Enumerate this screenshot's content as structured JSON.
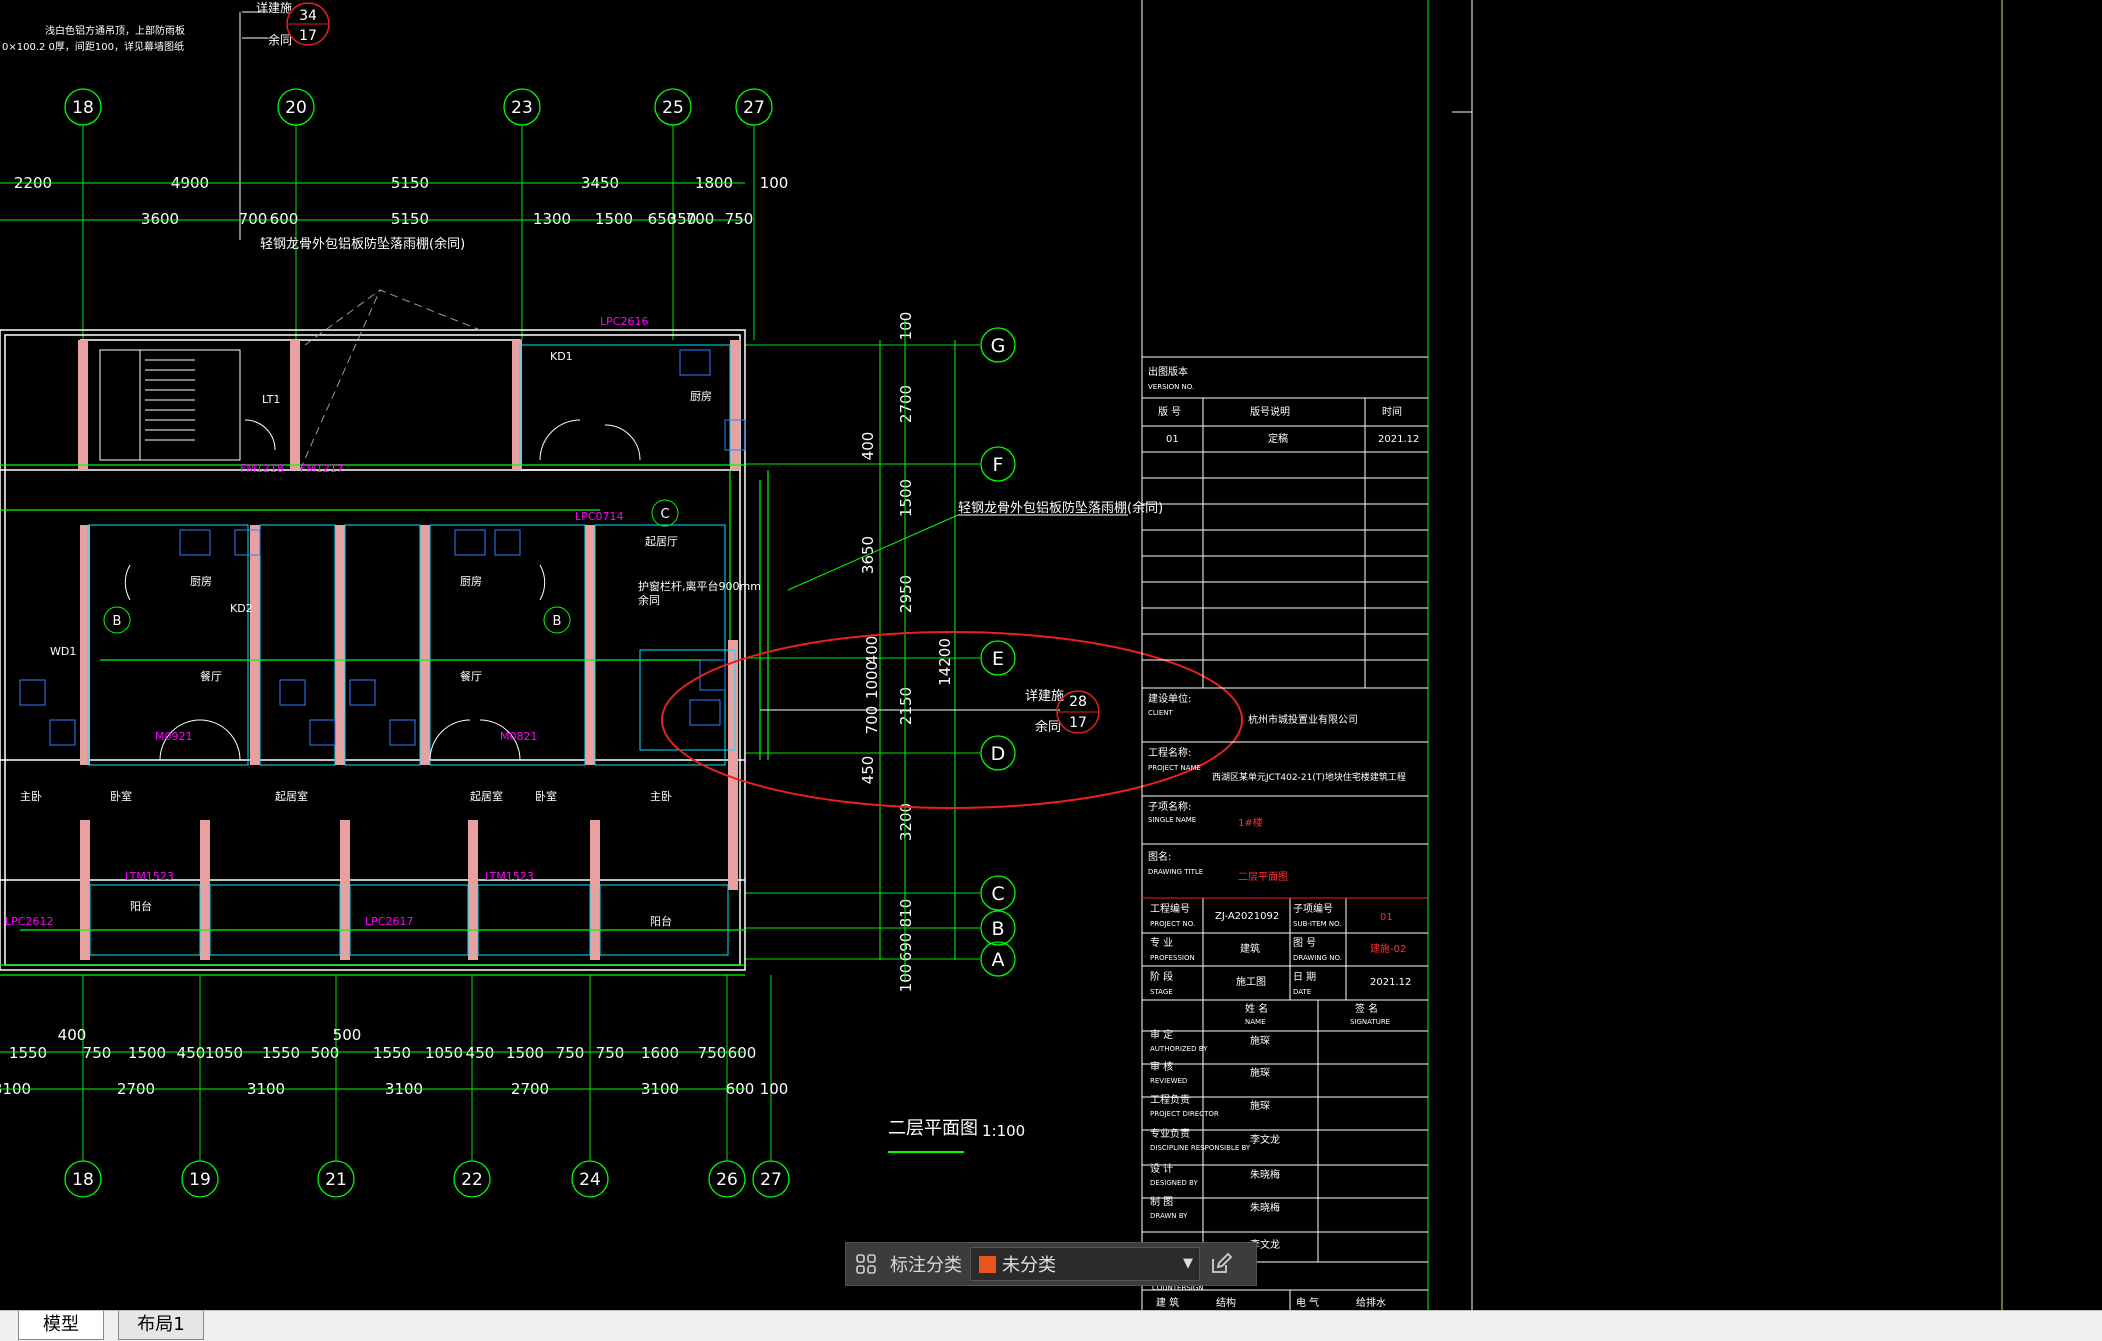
{
  "tabs": [
    {
      "label": "模型",
      "active": true
    },
    {
      "label": "布局1",
      "active": false
    }
  ],
  "annotation_toolbar": {
    "label": "标注分类",
    "selected_category": "未分类",
    "swatch_color": "#e8561b"
  },
  "drawing": {
    "title": "二层平面图",
    "scale": "1:100",
    "top_note_1": "浅白色铝方通吊顶，上部防雨板",
    "top_note_2": "0×100.2 0厚，间距100，详见幕墙图纸",
    "callout_label_1": "详建施",
    "callout_label_2": "余同",
    "callout_top_num": "34",
    "callout_top_sub": "17",
    "callout_right_num": "28",
    "callout_right_sub": "17",
    "canopy_note_1": "轻钢龙骨外包铝板防坠落雨棚(余同)",
    "canopy_note_2": "轻钢龙骨外包铝板防坠落雨棚(余同)",
    "guard_note_1": "护窗栏杆,离平台900mm",
    "guard_note_2": "余同",
    "colors": {
      "grid": "#00ff00",
      "wall": "#ffffff",
      "annotation": "#ff00ff",
      "revision_cloud": "#e82020",
      "title_red": "#ff3030"
    }
  },
  "grid_top_labels": [
    "18",
    "20",
    "23",
    "25",
    "27"
  ],
  "grid_bottom_labels": [
    "18",
    "19",
    "21",
    "22",
    "24",
    "26",
    "27"
  ],
  "grid_right_labels": [
    "G",
    "F",
    "E",
    "D",
    "C",
    "B",
    "A"
  ],
  "dim_top_row1": [
    "2200",
    "4900",
    "5150",
    "3450",
    "1800",
    "100"
  ],
  "dim_top_row2": [
    "3600",
    "700",
    "600",
    "5150",
    "1300",
    "1500",
    "650",
    "700",
    "750",
    "350"
  ],
  "dim_bottom_row1": [
    "1550",
    "750",
    "1500",
    "450",
    "1050",
    "1550",
    "500",
    "1550",
    "1050",
    "450",
    "1500",
    "750",
    "750",
    "1600",
    "750",
    "600"
  ],
  "dim_bottom_row2": [
    "3100",
    "2700",
    "3100",
    "3100",
    "2700",
    "3100",
    "600",
    "100"
  ],
  "dim_bottom_misc": [
    "400",
    "500"
  ],
  "dim_right_outer": [
    "100",
    "2700",
    "1500",
    "2950",
    "2150",
    "3200",
    "810",
    "690",
    "100"
  ],
  "dim_right_inner": [
    "400",
    "3650",
    "14200",
    "400",
    "1000",
    "700",
    "450"
  ],
  "room_labels": [
    "厨房",
    "餐厅",
    "起居室",
    "卧室",
    "主卧",
    "阳台",
    "厨房",
    "餐厅",
    "起居室",
    "卧室",
    "起居厅",
    "厨房",
    "主卧",
    "阳台",
    "LT1",
    "KD1",
    "KD2",
    "WD1"
  ],
  "door_tags": [
    "M0921",
    "M0821",
    "FM1218",
    "FM1217",
    "LPC0714",
    "LPC2616",
    "LTM1523",
    "LTM1523",
    "LPC2612",
    "LPC2617"
  ],
  "title_block": {
    "version_label": "出图版本",
    "version_label_en": "VERSION NO.",
    "header_cols": [
      "版 号",
      "版号说明",
      "时间"
    ],
    "version_row": [
      "01",
      "定稿",
      "2021.12"
    ],
    "client_label": "建设单位:",
    "client_label_en": "CLIENT",
    "client_value": "杭州市城投置业有限公司",
    "project_label": "工程名称:",
    "project_label_en": "PROJECT NAME",
    "project_value": "西湖区某单元JCT402-21(T)地块住宅楼建筑工程",
    "single_label": "子项名称:",
    "single_label_en": "SINGLE NAME",
    "single_value": "1#楼",
    "drawing_title_label": "图名:",
    "drawing_title_label_en": "DRAWING TITLE",
    "drawing_title_value": "二层平面图",
    "project_no_label": "工程编号",
    "project_no_label_en": "PROJECT NO.",
    "project_no_value": "ZJ-A2021092",
    "subitem_label": "子项编号",
    "subitem_label_en": "SUB-ITEM NO.",
    "subitem_value": "01",
    "profession_label": "专 业",
    "profession_label_en": "PROFESSION",
    "profession_value": "建筑",
    "drawing_no_label": "图 号",
    "drawing_no_label_en": "DRAWING NO.",
    "drawing_no_value": "建施-02",
    "stage_label": "阶 段",
    "stage_label_en": "STAGE",
    "stage_value": "施工图",
    "date_label": "日 期",
    "date_label_en": "DATE",
    "date_value": "2021.12",
    "name_head": "姓 名",
    "name_head_en": "NAME",
    "signature_head": "签 名",
    "signature_head_en": "SIGNATURE",
    "roles": [
      {
        "label": "审 定",
        "en": "AUTHORIZED BY",
        "name": "施琛"
      },
      {
        "label": "审 核",
        "en": "REVIEWED",
        "name": "施琛"
      },
      {
        "label": "工程负责",
        "en": "PROJECT DIRECTOR",
        "name": "施琛"
      },
      {
        "label": "专业负责",
        "en": "DISCIPLINE RESPONSIBLE BY",
        "name": "李文龙"
      },
      {
        "label": "设 计",
        "en": "DESIGNED BY",
        "name": "朱晓梅"
      },
      {
        "label": "制 图",
        "en": "DRAWN BY",
        "name": "朱晓梅"
      },
      {
        "label": "",
        "en": "",
        "name": "李文龙"
      }
    ],
    "countersign_label": "COUNTERSIGN",
    "bottom_cells": [
      "建 筑",
      "结构",
      "电 气",
      "给排水"
    ]
  }
}
